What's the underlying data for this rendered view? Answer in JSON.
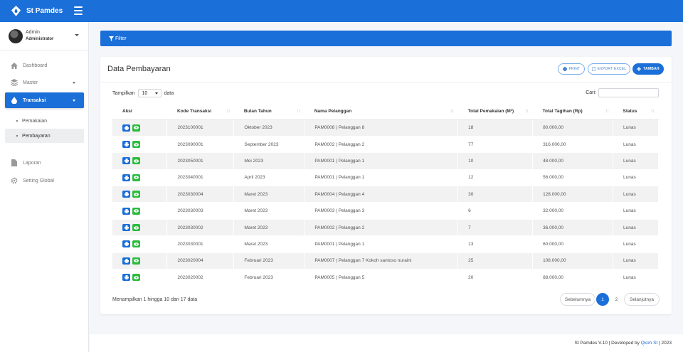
{
  "app": {
    "title": "St Pamdes"
  },
  "user": {
    "name": "Admin",
    "role": "Administrator"
  },
  "sidebar": {
    "items": [
      {
        "label": "Dashboard",
        "icon": "home-icon"
      },
      {
        "label": "Master",
        "icon": "database-icon"
      },
      {
        "label": "Transaksi",
        "icon": "water-drop-icon"
      },
      {
        "label": "Laporan",
        "icon": "document-icon"
      },
      {
        "label": "Setting Global",
        "icon": "gear-icon"
      }
    ],
    "subitems": [
      {
        "label": "Pemakaian"
      },
      {
        "label": "Pembayaran"
      }
    ]
  },
  "filter": {
    "label": "Filter"
  },
  "card": {
    "title": "Data Pembayaran",
    "print_label": "PRINT",
    "export_label": "EXPORT EXCEL",
    "add_label": "TAMBAH"
  },
  "controls": {
    "show_prefix": "Tampilkan",
    "page_size": "10",
    "show_suffix": "data",
    "search_label": "Cari:"
  },
  "table": {
    "headers": [
      "Aksi",
      "Kode Transaksi",
      "Bulan Tahun",
      "Nama Pelanggan",
      "Total Pemakaian (M³)",
      "Total Tagihan (Rp)",
      "Status"
    ],
    "rows": [
      [
        "2023100001",
        "Oktober 2023",
        "PAM0008 | Pelanggan 8",
        "18",
        "80.000,00",
        "Lunas"
      ],
      [
        "2023090001",
        "September 2023",
        "PAM0002 | Pelanggan 2",
        "77",
        "316.000,00",
        "Lunas"
      ],
      [
        "2023050001",
        "Mei 2023",
        "PAM0001 | Pelanggan 1",
        "10",
        "48.000,00",
        "Lunas"
      ],
      [
        "2023040001",
        "April 2023",
        "PAM0001 | Pelanggan 1",
        "12",
        "56.000,00",
        "Lunas"
      ],
      [
        "2023030004",
        "Maret 2023",
        "PAM0004 | Pelanggan 4",
        "30",
        "128.000,00",
        "Lunas"
      ],
      [
        "2023030003",
        "Maret 2023",
        "PAM0003 | Pelanggan 3",
        "6",
        "32.000,00",
        "Lunas"
      ],
      [
        "2023030002",
        "Maret 2023",
        "PAM0002 | Pelanggan 2",
        "7",
        "36.000,00",
        "Lunas"
      ],
      [
        "2023030001",
        "Maret 2023",
        "PAM0001 | Pelanggan 1",
        "13",
        "60.000,00",
        "Lunas"
      ],
      [
        "2023020004",
        "Februari 2023",
        "PAM0007 | Pelanggan 7 Kokoh santoso nuraini",
        "25",
        "108.000,00",
        "Lunas"
      ],
      [
        "2023020002",
        "Februari 2023",
        "PAM0005 | Pelanggan 5",
        "20",
        "88.000,00",
        "Lunas"
      ]
    ]
  },
  "pagination": {
    "info": "Menampilkan 1 hingga 10 dari 17 data",
    "prev": "Sebelumnya",
    "pages": [
      "1",
      "2"
    ],
    "next": "Selanjutnya",
    "current": "1"
  },
  "footer": {
    "text": "St Pamdes V.10 | Developed by",
    "link": "Qkoh St",
    "year": "| 2023"
  },
  "colors": {
    "primary": "#1b6fd8",
    "success": "#2dbb3f"
  }
}
